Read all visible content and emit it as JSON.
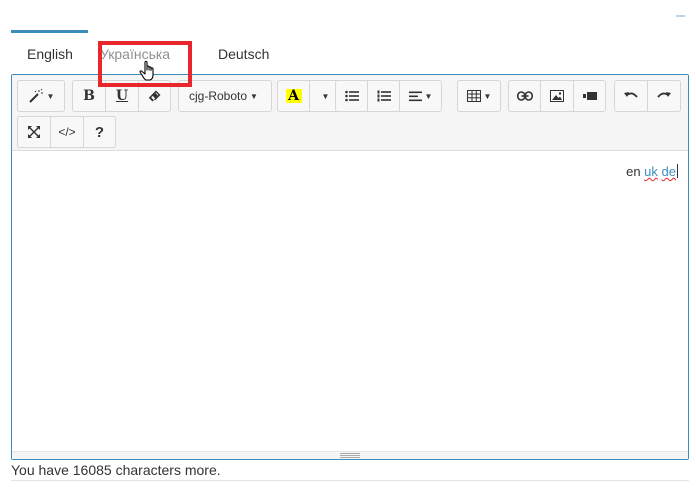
{
  "tabs": [
    {
      "label": "English"
    },
    {
      "label": "Українська"
    },
    {
      "label": "Deutsch"
    }
  ],
  "toolbar": {
    "font_name": "cjg-Roboto",
    "help_label": "?",
    "code_label": "</>",
    "bold_label": "B",
    "underline_label": "U",
    "color_label": "A"
  },
  "editor": {
    "content_prefix": "en ",
    "content_link_uk": "uk",
    "content_link_de": "de"
  },
  "status": {
    "char_count_text": "You have 16085 characters more."
  },
  "colors": {
    "accent": "#3c8dbc",
    "highlight": "#e8262c"
  }
}
